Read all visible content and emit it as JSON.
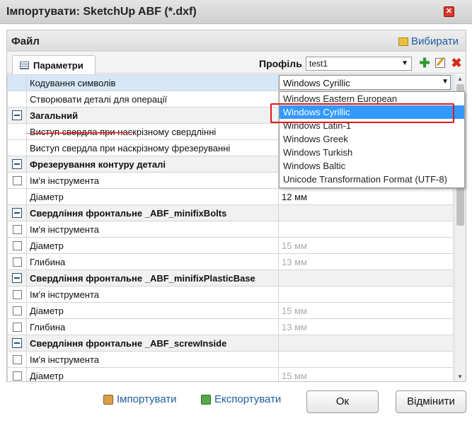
{
  "window": {
    "title": "Імпортувати: SketchUp ABF (*.dxf)"
  },
  "header": {
    "file_label": "Файл",
    "select_label": "Вибирати"
  },
  "tabs": {
    "params_label": "Параметри"
  },
  "profile": {
    "label": "Профіль",
    "value": "test1"
  },
  "rows": {
    "r1": {
      "name": "Кодування символів",
      "value": "Windows Cyrillic"
    },
    "r2": {
      "name": "Створювати деталі для операції"
    },
    "g1": {
      "name": "Загальний"
    },
    "r3": {
      "name": "Виступ свердла при наскрізному свердлінні"
    },
    "r4": {
      "name": "Виступ свердла при наскрізному фрезеруванні"
    },
    "g2": {
      "name": "Фрезерування контуру деталі"
    },
    "r5": {
      "name": "Ім'я інструмента"
    },
    "r6": {
      "name": "Діаметр",
      "value": "12 мм"
    },
    "g3": {
      "name": "Свердління фронтальне _ABF_minifixBolts"
    },
    "r7": {
      "name": "Ім'я інструмента"
    },
    "r8": {
      "name": "Діаметр",
      "value": "15 мм"
    },
    "r9": {
      "name": "Глибина",
      "value": "13 мм"
    },
    "g4": {
      "name": "Свердління фронтальне _ABF_minifixPlasticBase"
    },
    "r10": {
      "name": "Ім'я інструмента"
    },
    "r11": {
      "name": "Діаметр",
      "value": "15 мм"
    },
    "r12": {
      "name": "Глибина",
      "value": "13 мм"
    },
    "g5": {
      "name": "Свердління фронтальне _ABF_screwInside"
    },
    "r13": {
      "name": "Ім'я інструмента"
    },
    "r14": {
      "name": "Діаметр",
      "value": "15 мм"
    }
  },
  "dropdown": {
    "items": [
      "Windows Eastern European",
      "Windows Cyrillic",
      "Windows Latin-1",
      "Windows Greek",
      "Windows Turkish",
      "Windows Baltic",
      "Unicode Transformation Format (UTF-8)"
    ],
    "selected": "Windows Cyrillic"
  },
  "footer": {
    "import_label": "Імпортувати",
    "export_label": "Експортувати",
    "ok_label": "Ок",
    "cancel_label": "Відмінити"
  },
  "colors": {
    "link": "#1e5fa0",
    "selection": "#3399ff",
    "annotation": "#e01818"
  }
}
